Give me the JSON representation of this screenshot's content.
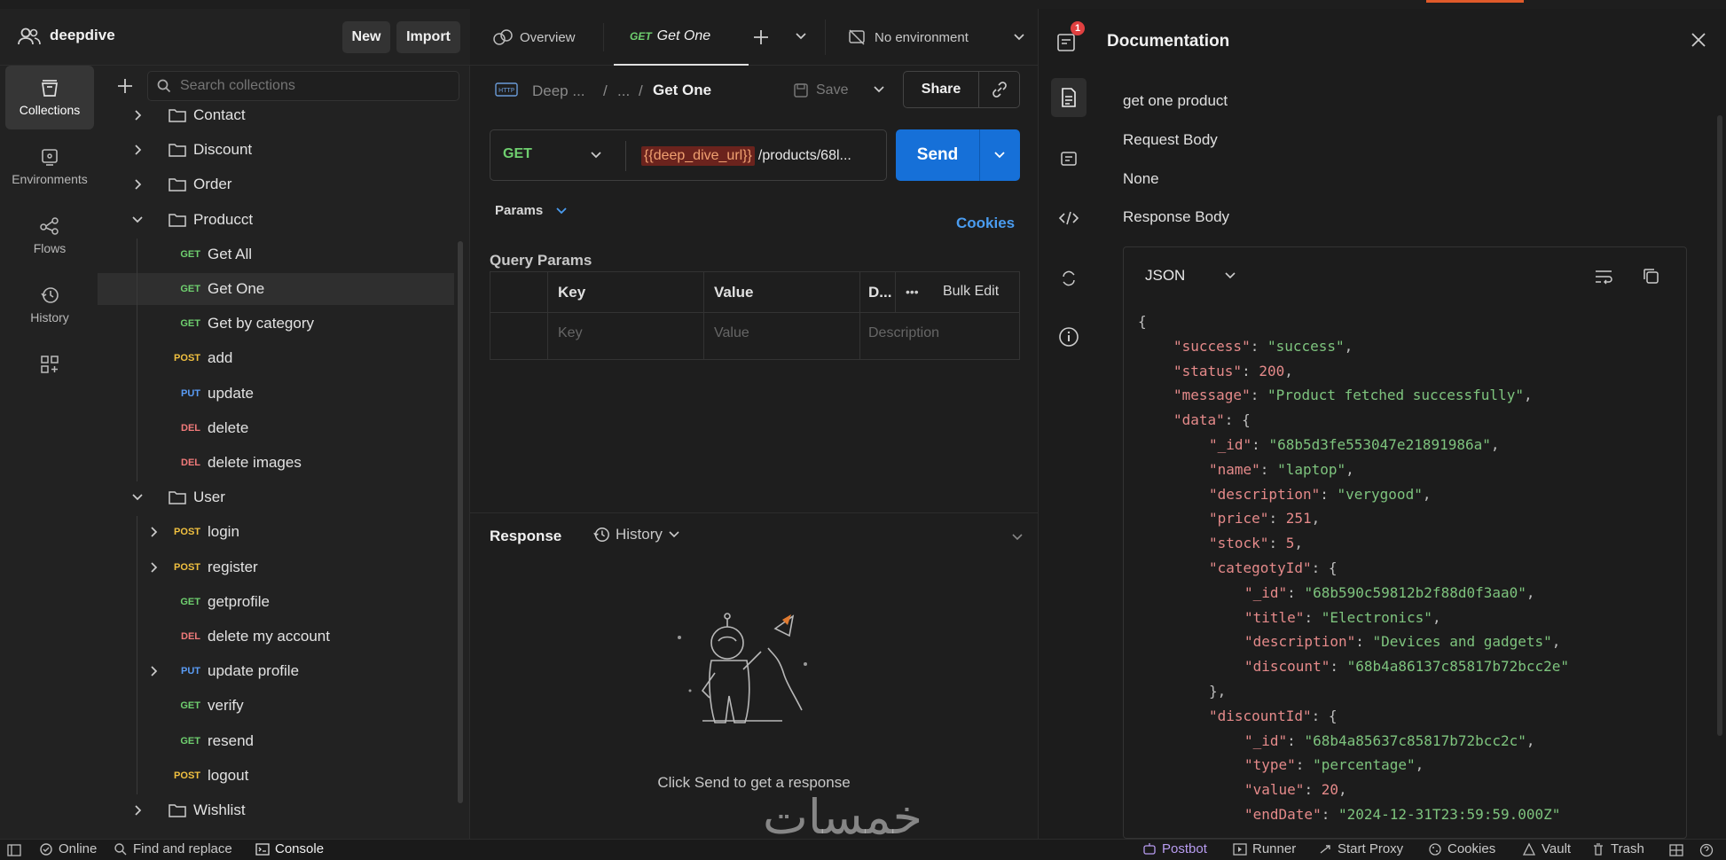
{
  "workspace": {
    "name": "deepdive",
    "new_label": "New",
    "import_label": "Import"
  },
  "rail": [
    {
      "label": "Collections",
      "icon": "collections-icon"
    },
    {
      "label": "Environments",
      "icon": "environments-icon"
    },
    {
      "label": "Flows",
      "icon": "flows-icon"
    },
    {
      "label": "History",
      "icon": "history-icon"
    },
    {
      "label": "",
      "icon": "apps-icon"
    }
  ],
  "sidebar": {
    "search_placeholder": "Search collections",
    "tree": [
      {
        "kind": "folder",
        "label": "Contact",
        "expanded": false
      },
      {
        "kind": "folder",
        "label": "Discount",
        "expanded": false
      },
      {
        "kind": "folder",
        "label": "Order",
        "expanded": false
      },
      {
        "kind": "folder",
        "label": "Producct",
        "expanded": true
      },
      {
        "kind": "request",
        "method": "GET",
        "label": "Get All"
      },
      {
        "kind": "request",
        "method": "GET",
        "label": "Get One",
        "selected": true
      },
      {
        "kind": "request",
        "method": "GET",
        "label": "Get by category"
      },
      {
        "kind": "request",
        "method": "POST",
        "label": "add"
      },
      {
        "kind": "request",
        "method": "PUT",
        "label": "update"
      },
      {
        "kind": "request",
        "method": "DEL",
        "label": "delete"
      },
      {
        "kind": "request",
        "method": "DEL",
        "label": "delete images"
      },
      {
        "kind": "folder",
        "label": "User",
        "expanded": true
      },
      {
        "kind": "request",
        "method": "POST",
        "label": "login",
        "chevron": true
      },
      {
        "kind": "request",
        "method": "POST",
        "label": "register",
        "chevron": true
      },
      {
        "kind": "request",
        "method": "GET",
        "label": "getprofile"
      },
      {
        "kind": "request",
        "method": "DEL",
        "label": "delete my account"
      },
      {
        "kind": "request",
        "method": "PUT",
        "label": "update profile",
        "chevron": true
      },
      {
        "kind": "request",
        "method": "GET",
        "label": "verify"
      },
      {
        "kind": "request",
        "method": "GET",
        "label": "resend"
      },
      {
        "kind": "request",
        "method": "POST",
        "label": "logout"
      },
      {
        "kind": "folder",
        "label": "Wishlist",
        "expanded": false
      }
    ]
  },
  "tabs": {
    "overview": "Overview",
    "active_method": "GET",
    "active_name": "Get One",
    "environment": "No environment"
  },
  "request": {
    "breadcrumb_collection": "Deep ...",
    "breadcrumb_ellipsis": "...",
    "breadcrumb_name": "Get One",
    "save_label": "Save",
    "share_label": "Share",
    "method": "GET",
    "url_variable": "{{deep_dive_url}}",
    "url_rest": "/products/68l...",
    "send_label": "Send",
    "params_label": "Params",
    "cookies_label": "Cookies",
    "query_params_label": "Query Params",
    "columns": {
      "key": "Key",
      "value": "Value",
      "desc": "D...",
      "bulk_edit": "Bulk Edit"
    },
    "placeholders": {
      "key": "Key",
      "value": "Value",
      "desc": "Description"
    }
  },
  "response": {
    "label": "Response",
    "history_label": "History",
    "empty_text": "Click Send to get a response"
  },
  "documentation": {
    "title": "Documentation",
    "notification_count": "1",
    "description": "get one product",
    "request_body_label": "Request Body",
    "request_body_value": "None",
    "response_body_label": "Response Body",
    "format": "JSON",
    "json_lines": [
      {
        "indent": 0,
        "parts": [
          [
            "p",
            "{"
          ]
        ]
      },
      {
        "indent": 1,
        "parts": [
          [
            "k",
            "\"success\""
          ],
          [
            "p",
            ": "
          ],
          [
            "s",
            "\"success\""
          ],
          [
            "p",
            ","
          ]
        ]
      },
      {
        "indent": 1,
        "parts": [
          [
            "k",
            "\"status\""
          ],
          [
            "p",
            ": "
          ],
          [
            "n",
            "200"
          ],
          [
            "p",
            ","
          ]
        ]
      },
      {
        "indent": 1,
        "parts": [
          [
            "k",
            "\"message\""
          ],
          [
            "p",
            ": "
          ],
          [
            "s",
            "\"Product fetched successfully\""
          ],
          [
            "p",
            ","
          ]
        ]
      },
      {
        "indent": 1,
        "parts": [
          [
            "k",
            "\"data\""
          ],
          [
            "p",
            ": {"
          ]
        ]
      },
      {
        "indent": 2,
        "parts": [
          [
            "k",
            "\"_id\""
          ],
          [
            "p",
            ": "
          ],
          [
            "s",
            "\"68b5d3fe553047e21891986a\""
          ],
          [
            "p",
            ","
          ]
        ]
      },
      {
        "indent": 2,
        "parts": [
          [
            "k",
            "\"name\""
          ],
          [
            "p",
            ": "
          ],
          [
            "s",
            "\"laptop\""
          ],
          [
            "p",
            ","
          ]
        ]
      },
      {
        "indent": 2,
        "parts": [
          [
            "k",
            "\"description\""
          ],
          [
            "p",
            ": "
          ],
          [
            "s",
            "\"verygood\""
          ],
          [
            "p",
            ","
          ]
        ]
      },
      {
        "indent": 2,
        "parts": [
          [
            "k",
            "\"price\""
          ],
          [
            "p",
            ": "
          ],
          [
            "n",
            "251"
          ],
          [
            "p",
            ","
          ]
        ]
      },
      {
        "indent": 2,
        "parts": [
          [
            "k",
            "\"stock\""
          ],
          [
            "p",
            ": "
          ],
          [
            "n",
            "5"
          ],
          [
            "p",
            ","
          ]
        ]
      },
      {
        "indent": 2,
        "parts": [
          [
            "k",
            "\"categotyId\""
          ],
          [
            "p",
            ": {"
          ]
        ]
      },
      {
        "indent": 3,
        "parts": [
          [
            "k",
            "\"_id\""
          ],
          [
            "p",
            ": "
          ],
          [
            "s",
            "\"68b590c59812b2f88d0f3aa0\""
          ],
          [
            "p",
            ","
          ]
        ]
      },
      {
        "indent": 3,
        "parts": [
          [
            "k",
            "\"title\""
          ],
          [
            "p",
            ": "
          ],
          [
            "s",
            "\"Electronics\""
          ],
          [
            "p",
            ","
          ]
        ]
      },
      {
        "indent": 3,
        "parts": [
          [
            "k",
            "\"description\""
          ],
          [
            "p",
            ": "
          ],
          [
            "s",
            "\"Devices and gadgets\""
          ],
          [
            "p",
            ","
          ]
        ]
      },
      {
        "indent": 3,
        "parts": [
          [
            "k",
            "\"discount\""
          ],
          [
            "p",
            ": "
          ],
          [
            "s",
            "\"68b4a86137c85817b72bcc2e\""
          ]
        ]
      },
      {
        "indent": 2,
        "parts": [
          [
            "p",
            "},"
          ]
        ]
      },
      {
        "indent": 2,
        "parts": [
          [
            "k",
            "\"discountId\""
          ],
          [
            "p",
            ": {"
          ]
        ]
      },
      {
        "indent": 3,
        "parts": [
          [
            "k",
            "\"_id\""
          ],
          [
            "p",
            ": "
          ],
          [
            "s",
            "\"68b4a85637c85817b72bcc2c\""
          ],
          [
            "p",
            ","
          ]
        ]
      },
      {
        "indent": 3,
        "parts": [
          [
            "k",
            "\"type\""
          ],
          [
            "p",
            ": "
          ],
          [
            "s",
            "\"percentage\""
          ],
          [
            "p",
            ","
          ]
        ]
      },
      {
        "indent": 3,
        "parts": [
          [
            "k",
            "\"value\""
          ],
          [
            "p",
            ": "
          ],
          [
            "n",
            "20"
          ],
          [
            "p",
            ","
          ]
        ]
      },
      {
        "indent": 3,
        "parts": [
          [
            "k",
            "\"endDate\""
          ],
          [
            "p",
            ": "
          ],
          [
            "s",
            "\"2024-12-31T23:59:59.000Z\""
          ]
        ]
      }
    ]
  },
  "statusbar": {
    "online": "Online",
    "find_replace": "Find and replace",
    "console": "Console",
    "postbot": "Postbot",
    "runner": "Runner",
    "start_proxy": "Start Proxy",
    "cookies": "Cookies",
    "vault": "Vault",
    "trash": "Trash"
  },
  "watermark": "خمسات",
  "colors": {
    "accent_blue": "#1670d8",
    "get": "#6fcf6f",
    "post": "#f0c040",
    "put": "#5a9cf5",
    "del": "#f07a7a",
    "variable_bg": "#7a2420",
    "variable_text": "#f0a070"
  }
}
